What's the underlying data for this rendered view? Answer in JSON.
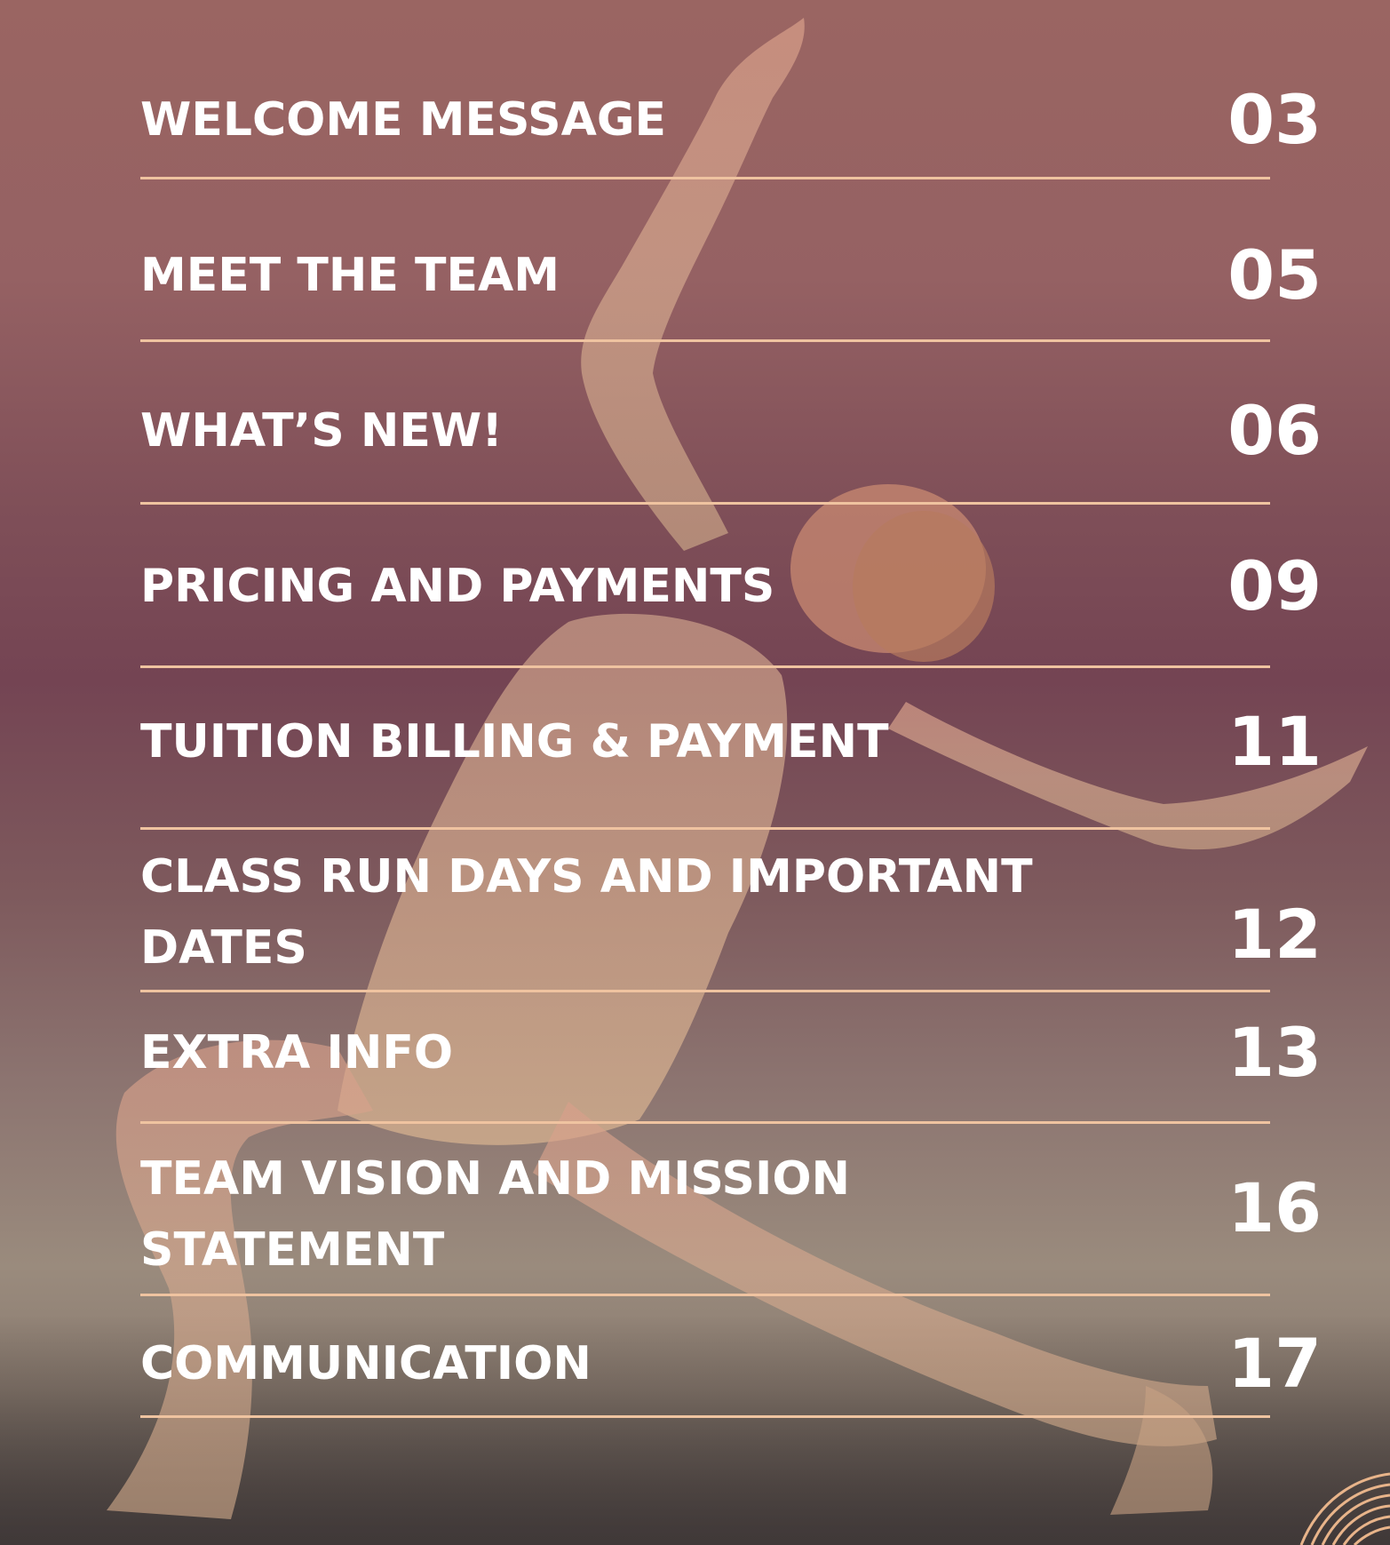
{
  "toc": [
    {
      "title": "WELCOME MESSAGE",
      "page": "03"
    },
    {
      "title": "MEET THE TEAM",
      "page": "05"
    },
    {
      "title": "WHAT’S NEW!",
      "page": "06"
    },
    {
      "title": "PRICING AND PAYMENTS",
      "page": "09"
    },
    {
      "title": "TUITION BILLING & PAYMENT",
      "page": "11"
    },
    {
      "title": "CLASS RUN DAYS AND IMPORTANT DATES",
      "page": "12"
    },
    {
      "title": "EXTRA INFO",
      "page": "13"
    },
    {
      "title": "TEAM VISION AND MISSION STATEMENT",
      "page": "16"
    },
    {
      "title": "COMMUNICATION",
      "page": "17"
    }
  ],
  "colors": {
    "rule": "#efc3a0",
    "text": "#ffffff",
    "overlay_top": "#9a6562",
    "overlay_mid": "#744453",
    "overlay_bottom": "#9a8b7d"
  },
  "icons": {
    "background": "dancer-photo",
    "corner": "curved-lines-decoration-icon"
  }
}
